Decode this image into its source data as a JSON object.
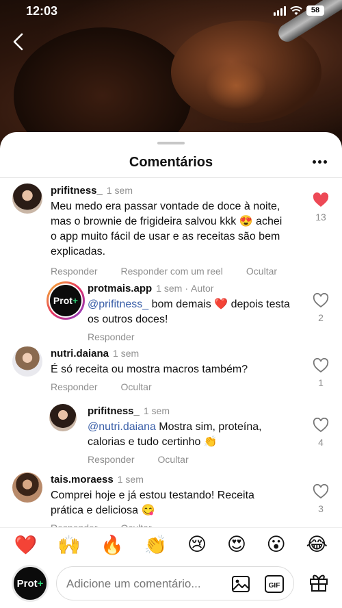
{
  "status_bar": {
    "time": "12:03",
    "battery": "58"
  },
  "sheet": {
    "title": "Comentários"
  },
  "comments": [
    {
      "user": "prifitness_",
      "time": "1 sem",
      "text": "Meu medo era passar vontade de doce à noite, mas o brownie de frigideira salvou kkk 😍 achei o app muito fácil de usar e as receitas são bem explicadas.",
      "likes": "13",
      "liked": true,
      "actions": [
        "Responder",
        "Responder com um reel",
        "Ocultar"
      ]
    },
    {
      "user": "protmais.app",
      "time": "1 sem",
      "badge": "Autor",
      "mention": "@prifitness_",
      "text": " bom demais ❤️ depois testa os outros doces!",
      "likes": "2",
      "actions": [
        "Responder"
      ]
    },
    {
      "user": "nutri.daiana",
      "time": "1 sem",
      "text": "É só receita ou mostra macros também?",
      "likes": "1",
      "actions": [
        "Responder",
        "Ocultar"
      ]
    },
    {
      "user": "prifitness_",
      "time": "1 sem",
      "mention": "@nutri.daiana",
      "text": " Mostra sim, proteína, calorias e tudo certinho 👏",
      "likes": "4",
      "actions": [
        "Responder",
        "Ocultar"
      ]
    },
    {
      "user": "tais.moraess",
      "time": "1 sem",
      "text": "Comprei hoje e já estou testando! Receita prática e deliciosa 😋",
      "likes": "3",
      "actions": [
        "Responder",
        "Ocultar"
      ]
    }
  ],
  "brand_avatar": {
    "text": "Prot",
    "plus": "+"
  },
  "reactions": [
    "❤️",
    "🙌",
    "🔥",
    "👏",
    "😢",
    "😍",
    "😮",
    "😂"
  ],
  "composer": {
    "placeholder": "Adicione um comentário..."
  },
  "colors": {
    "like_red": "#ed4956",
    "mention_blue": "#3a5fa8",
    "brand_green": "#2fd67a"
  }
}
